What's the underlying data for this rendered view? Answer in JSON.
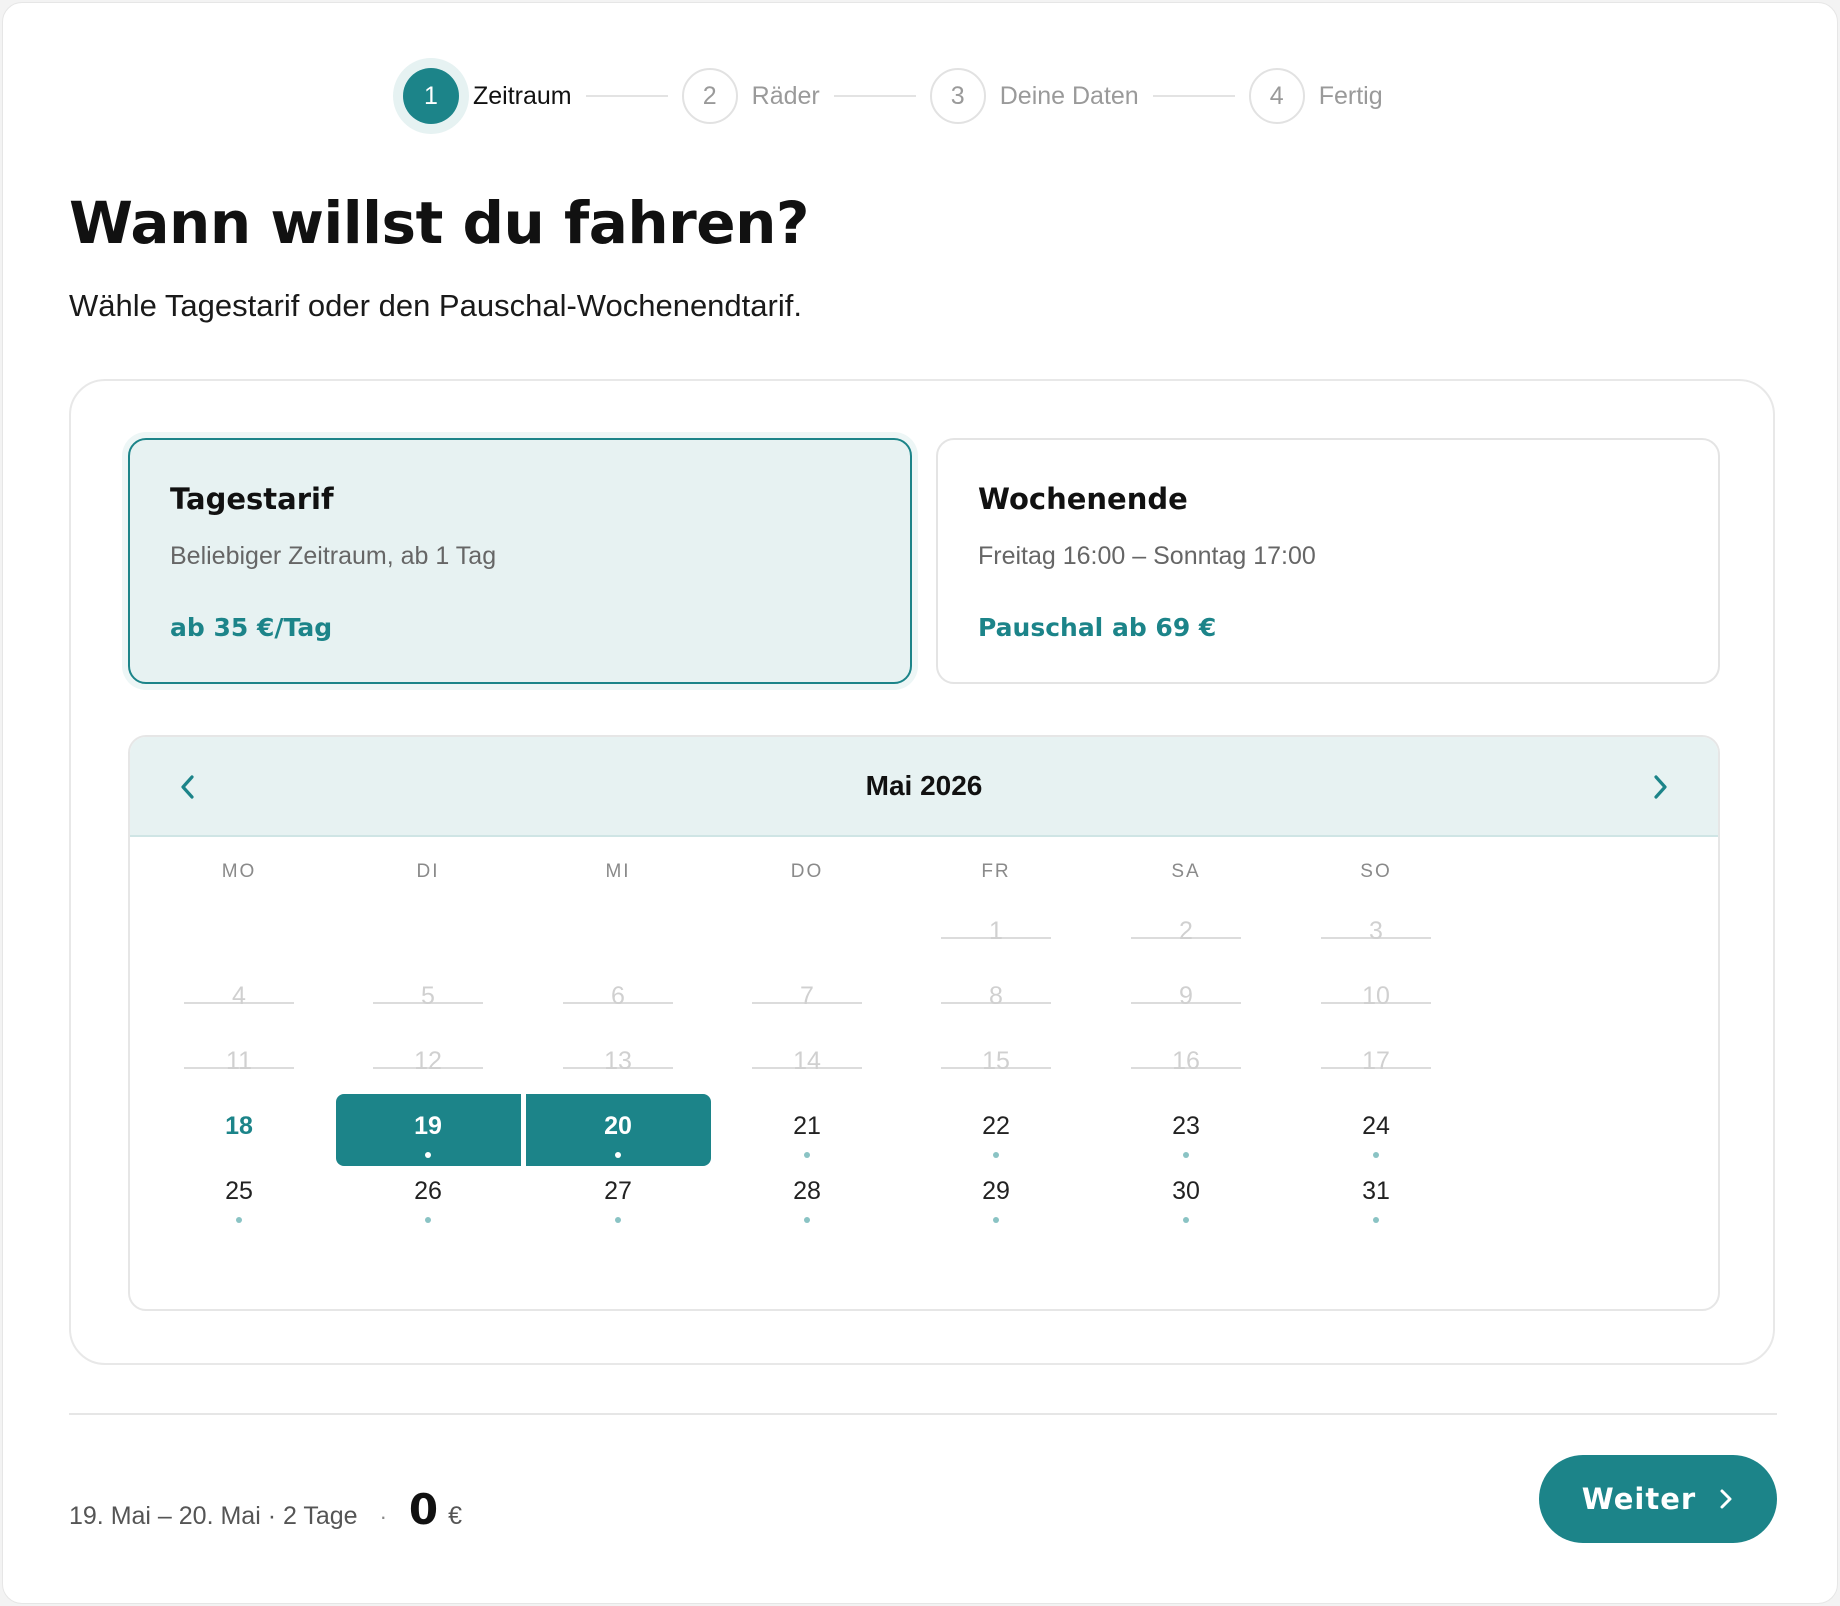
{
  "stepper": {
    "steps": [
      {
        "number": "1",
        "label": "Zeitraum",
        "active": true
      },
      {
        "number": "2",
        "label": "Räder",
        "active": false
      },
      {
        "number": "3",
        "label": "Deine Daten",
        "active": false
      },
      {
        "number": "4",
        "label": "Fertig",
        "active": false
      }
    ]
  },
  "header": {
    "title": "Wann willst du fahren?",
    "subtitle": "Wähle Tagestarif oder den Pauschal-Wochenendtarif."
  },
  "tariffs": [
    {
      "title": "Tagestarif",
      "description": "Beliebiger Zeitraum, ab 1 Tag",
      "price": "ab 35 €/Tag",
      "selected": true
    },
    {
      "title": "Wochenende",
      "description": "Freitag 16:00 – Sonntag 17:00",
      "price": "Pauschal ab 69 €",
      "selected": false
    }
  ],
  "calendar": {
    "month_label": "Mai 2026",
    "prev_icon": "chevron-left-icon",
    "next_icon": "chevron-right-icon",
    "weekdays": [
      "MO",
      "DI",
      "MI",
      "DO",
      "FR",
      "SA",
      "SO"
    ],
    "first_weekday_index": 4,
    "days": [
      {
        "d": "1",
        "state": "disabled"
      },
      {
        "d": "2",
        "state": "disabled"
      },
      {
        "d": "3",
        "state": "disabled"
      },
      {
        "d": "4",
        "state": "disabled"
      },
      {
        "d": "5",
        "state": "disabled"
      },
      {
        "d": "6",
        "state": "disabled"
      },
      {
        "d": "7",
        "state": "disabled"
      },
      {
        "d": "8",
        "state": "disabled"
      },
      {
        "d": "9",
        "state": "disabled"
      },
      {
        "d": "10",
        "state": "disabled"
      },
      {
        "d": "11",
        "state": "disabled"
      },
      {
        "d": "12",
        "state": "disabled"
      },
      {
        "d": "13",
        "state": "disabled"
      },
      {
        "d": "14",
        "state": "disabled"
      },
      {
        "d": "15",
        "state": "disabled"
      },
      {
        "d": "16",
        "state": "disabled"
      },
      {
        "d": "17",
        "state": "disabled"
      },
      {
        "d": "18",
        "state": "today"
      },
      {
        "d": "19",
        "state": "selected"
      },
      {
        "d": "20",
        "state": "selected"
      },
      {
        "d": "21",
        "state": "available"
      },
      {
        "d": "22",
        "state": "available"
      },
      {
        "d": "23",
        "state": "available"
      },
      {
        "d": "24",
        "state": "available"
      },
      {
        "d": "25",
        "state": "available"
      },
      {
        "d": "26",
        "state": "available"
      },
      {
        "d": "27",
        "state": "available"
      },
      {
        "d": "28",
        "state": "available"
      },
      {
        "d": "29",
        "state": "available"
      },
      {
        "d": "30",
        "state": "available"
      },
      {
        "d": "31",
        "state": "available"
      }
    ]
  },
  "footer": {
    "summary": "19. Mai – 20. Mai · 2 Tage",
    "separator": "·",
    "total": "0",
    "currency": "€",
    "next_label": "Weiter",
    "next_icon": "chevron-right-icon"
  },
  "colors": {
    "accent": "#1c8489",
    "accent_light": "#e7f2f2"
  }
}
